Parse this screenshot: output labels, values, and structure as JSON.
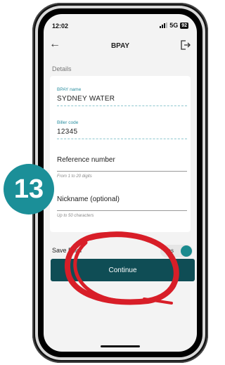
{
  "status_bar": {
    "time": "12:02",
    "network": "5G",
    "battery": "92"
  },
  "nav": {
    "back_icon": "arrow-left-icon",
    "title": "BPAY",
    "exit_icon": "logout-icon"
  },
  "section": {
    "label": "Details"
  },
  "form": {
    "biller_name": {
      "label": "BPAY name",
      "value": "SYDNEY WATER"
    },
    "biller_code": {
      "label": "Biller code",
      "value": "12345"
    },
    "reference": {
      "placeholder": "Reference number",
      "hint": "From 1 to 20 digits"
    },
    "nickname": {
      "placeholder": "Nickname (optional)",
      "hint": "Up to 50 characters"
    }
  },
  "save_biller": {
    "label": "Save Biller",
    "toggle_text": "Yes",
    "on": true
  },
  "continue_button": {
    "label": "Continue"
  },
  "step_badge": {
    "number": "13"
  },
  "colors": {
    "accent": "#1b8f98",
    "button": "#0f4d55",
    "annotation": "#d81e28"
  }
}
